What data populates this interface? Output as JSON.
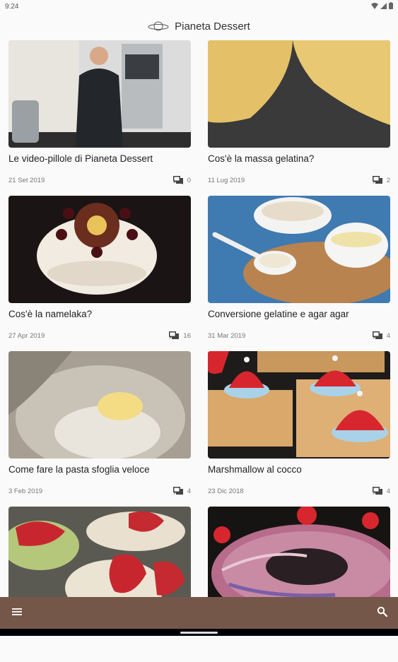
{
  "status": {
    "time": "9:24"
  },
  "app": {
    "title": "Pianeta Dessert"
  },
  "posts": [
    {
      "title": "Le video-pillole di Pianeta Dessert",
      "date": "21 Set 2019",
      "comments": "0",
      "image": "chef"
    },
    {
      "title": "Cos'è la massa gelatina?",
      "date": "11 Lug 2019",
      "comments": "2",
      "image": "gelatin"
    },
    {
      "title": "Cos'è la namelaka?",
      "date": "27 Apr 2019",
      "comments": "16",
      "image": "namelaka-cake"
    },
    {
      "title": "Conversione gelatine e agar agar",
      "date": "31 Mar 2019",
      "comments": "4",
      "image": "bowls"
    },
    {
      "title": "Come fare la pasta sfoglia veloce",
      "date": "3 Feb 2019",
      "comments": "4",
      "image": "mixer-dough"
    },
    {
      "title": "Marshmallow al cocco",
      "date": "23 Dic 2018",
      "comments": "4",
      "image": "marshmallow-hats"
    },
    {
      "title": "",
      "date": "",
      "comments": "",
      "image": "strawberry-tarts"
    },
    {
      "title": "",
      "date": "",
      "comments": "",
      "image": "glazed-ring-cake"
    }
  ],
  "colors": {
    "bottombar": "#75574a",
    "background": "#fafafa"
  },
  "icons": {
    "menu": "menu-icon",
    "search": "search-icon",
    "comment": "comment-icon",
    "logo": "planet-logo-icon"
  }
}
